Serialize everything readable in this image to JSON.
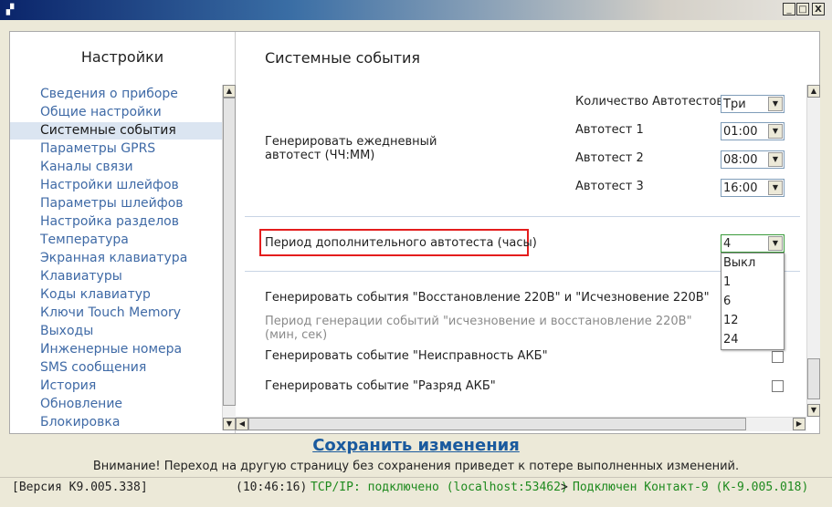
{
  "window": {
    "controls": [
      "_",
      "□",
      "X"
    ]
  },
  "sidebar": {
    "title": "Настройки",
    "items": [
      {
        "label": "Сведения о приборе"
      },
      {
        "label": "Общие настройки"
      },
      {
        "label": "Системные события"
      },
      {
        "label": "Параметры GPRS"
      },
      {
        "label": "Каналы связи"
      },
      {
        "label": "Настройки шлейфов"
      },
      {
        "label": "Параметры шлейфов"
      },
      {
        "label": "Настройка разделов"
      },
      {
        "label": "Температура"
      },
      {
        "label": "Экранная клавиатура"
      },
      {
        "label": "Клавиатуры"
      },
      {
        "label": "Коды клавиатур"
      },
      {
        "label": "Ключи Touch Memory"
      },
      {
        "label": "Выходы"
      },
      {
        "label": "Инженерные номера"
      },
      {
        "label": "SMS сообщения"
      },
      {
        "label": "История"
      },
      {
        "label": "Обновление"
      },
      {
        "label": "Блокировка"
      }
    ],
    "active_index": 2
  },
  "content": {
    "title": "Системные события",
    "autotest": {
      "label": "Генерировать ежедневный\nавтотест (ЧЧ:ММ)",
      "count_label": "Количество Автотестов",
      "count_value": "Три",
      "test1_label": "Автотест 1",
      "test1_value": "01:00",
      "test2_label": "Автотест 2",
      "test2_value": "08:00",
      "test3_label": "Автотест 3",
      "test3_value": "16:00"
    },
    "period": {
      "label": "Период дополнительного автотеста (часы)",
      "value": "4",
      "options": [
        "Выкл",
        "1",
        "6",
        "12",
        "24"
      ]
    },
    "power_events_label": "Генерировать события \"Восстановление 220В\" и \"Исчезновение 220В\"",
    "power_period_label": "Период генерации событий \"исчезновение и восстановление 220В\"\n(мин, сек)",
    "akb_fault_label": "Генерировать событие \"Неисправность АКБ\"",
    "akb_discharge_label": "Генерировать событие \"Разряд АКБ\""
  },
  "footer": {
    "save_label": "Сохранить изменения",
    "warning": "Внимание! Переход на другую страницу без сохранения приведет к потере выполненных изменений."
  },
  "status": {
    "version": "[Версия K9.005.338]",
    "time": "(10:46:16)",
    "connection": "TCP/IP: подключено (localhost:53462)",
    "arrow": ">",
    "device": "Подключен Контакт-9 (K-9.005.018)",
    "colors": {
      "connection": "#1e8a1e",
      "device": "#1e8a1e"
    }
  }
}
